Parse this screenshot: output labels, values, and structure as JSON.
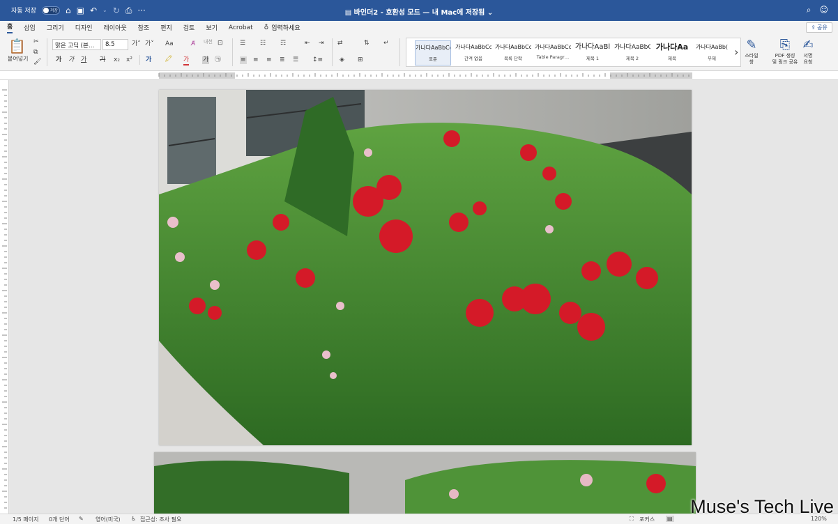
{
  "titlebar": {
    "autosave_label": "자동 저장",
    "autosave_state": "저장",
    "doc_title": "바인더2  -  호환성 모드 — 내 Mac에 저장됨 ⌄"
  },
  "tabs": [
    "홈",
    "삽입",
    "그리기",
    "디자인",
    "레이아웃",
    "참조",
    "편지",
    "검토",
    "보기",
    "Acrobat"
  ],
  "tell_me": "입력하세요",
  "share_label": "공유",
  "ribbon": {
    "paste_label": "붙여넣기",
    "font_name": "맑은 고딕 (본…",
    "font_size": "8.5",
    "grow_font": "가˄",
    "shrink_font": "가˅",
    "change_case": "Aa",
    "bold": "가",
    "italic": "가",
    "underline": "가",
    "strike": "가",
    "subscript": "x₂",
    "superscript": "x²",
    "text_effects": "가",
    "font_color": "가",
    "char_shading": "가",
    "enclose": "㉠"
  },
  "styles": [
    {
      "preview": "가나다AaBbCc",
      "name": "표준"
    },
    {
      "preview": "가나다AaBbCc",
      "name": "간격 없음"
    },
    {
      "preview": "가나다AaBbCc",
      "name": "목록 단락"
    },
    {
      "preview": "가나다AaBbCc",
      "name": "Table Paragr…"
    },
    {
      "preview": "가나다AaBl",
      "name": "제목 1"
    },
    {
      "preview": "가나다AaBbC",
      "name": "제목 2"
    },
    {
      "preview": "가나다Aa",
      "name": "제목"
    },
    {
      "preview": "가나다AaBb(",
      "name": "부제"
    }
  ],
  "styles_pane": {
    "line1": "스타일",
    "line2": "창"
  },
  "pdf_btn": {
    "line1": "PDF 생성",
    "line2": "및 링크 공유"
  },
  "sign_btn": {
    "line1": "서명",
    "line2": "요청"
  },
  "status": {
    "page": "1/5 페이지",
    "words": "0개 단어",
    "language": "영어(미국)",
    "accessibility": "접근성: 조사 필요",
    "focus": "포커스",
    "zoom": "120%"
  },
  "watermark": "Muse's Tech Live",
  "colors": {
    "titlebar": "#2b579a",
    "rose": "#d41a28",
    "foliage": "#3f8a2c"
  }
}
